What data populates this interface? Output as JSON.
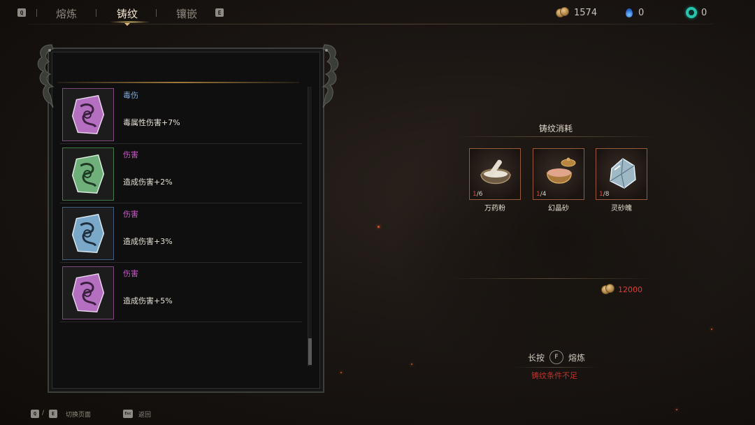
{
  "topbar": {
    "prev_key": "Q",
    "next_key": "E",
    "tabs": [
      {
        "label": "熔炼",
        "active": false
      },
      {
        "label": "铸纹",
        "active": true
      },
      {
        "label": "镶嵌",
        "active": false
      }
    ],
    "resources": [
      {
        "icon": "coin-icon",
        "value": "1574"
      },
      {
        "icon": "blue-flame-icon",
        "value": "0"
      },
      {
        "icon": "jade-ring-icon",
        "value": "0"
      }
    ]
  },
  "inscriptions": [
    {
      "title": "毒伤",
      "title_color": "#7fa9d8",
      "desc": "毒属性伤害+7%",
      "gem_color": "#b46fc0",
      "border_color": "#7a4a7e",
      "icon": "purple-rune-gem-icon"
    },
    {
      "title": "伤害",
      "title_color": "#c35ac2",
      "desc": "造成伤害+2%",
      "gem_color": "#6fb07a",
      "border_color": "#3f7a46",
      "icon": "green-rune-gem-icon"
    },
    {
      "title": "伤害",
      "title_color": "#c35ac2",
      "desc": "造成伤害+3%",
      "gem_color": "#7aa8c8",
      "border_color": "#3e607c",
      "icon": "blue-rune-gem-icon"
    },
    {
      "title": "伤害",
      "title_color": "#c35ac2",
      "desc": "造成伤害+5%",
      "gem_color": "#b46fc0",
      "border_color": "#7a4a7e",
      "icon": "purple-rune-gem-icon"
    }
  ],
  "consumption": {
    "title": "铸纹消耗",
    "materials": [
      {
        "name": "万药粉",
        "have": "1",
        "need": "6",
        "icon": "mortar-pestle-icon"
      },
      {
        "name": "幻晶砂",
        "have": "1",
        "need": "4",
        "icon": "sand-jar-icon"
      },
      {
        "name": "灵砂魄",
        "have": "1",
        "need": "8",
        "icon": "crystal-ore-icon"
      }
    ],
    "cost": "12000"
  },
  "action": {
    "hold_label": "长按",
    "key": "F",
    "action_label": "熔炼",
    "warning": "铸纹条件不足"
  },
  "hints": {
    "switch_key_q": "Q",
    "switch_key_e": "E",
    "switch_sep": "/",
    "switch_label": "切换页面",
    "back_key": "Esc",
    "back_label": "返回"
  },
  "colors": {
    "accent_gold": "#e8c77a",
    "warning_red": "#c2312b",
    "cost_red": "#e03c32",
    "have_red": "#e0473c"
  }
}
